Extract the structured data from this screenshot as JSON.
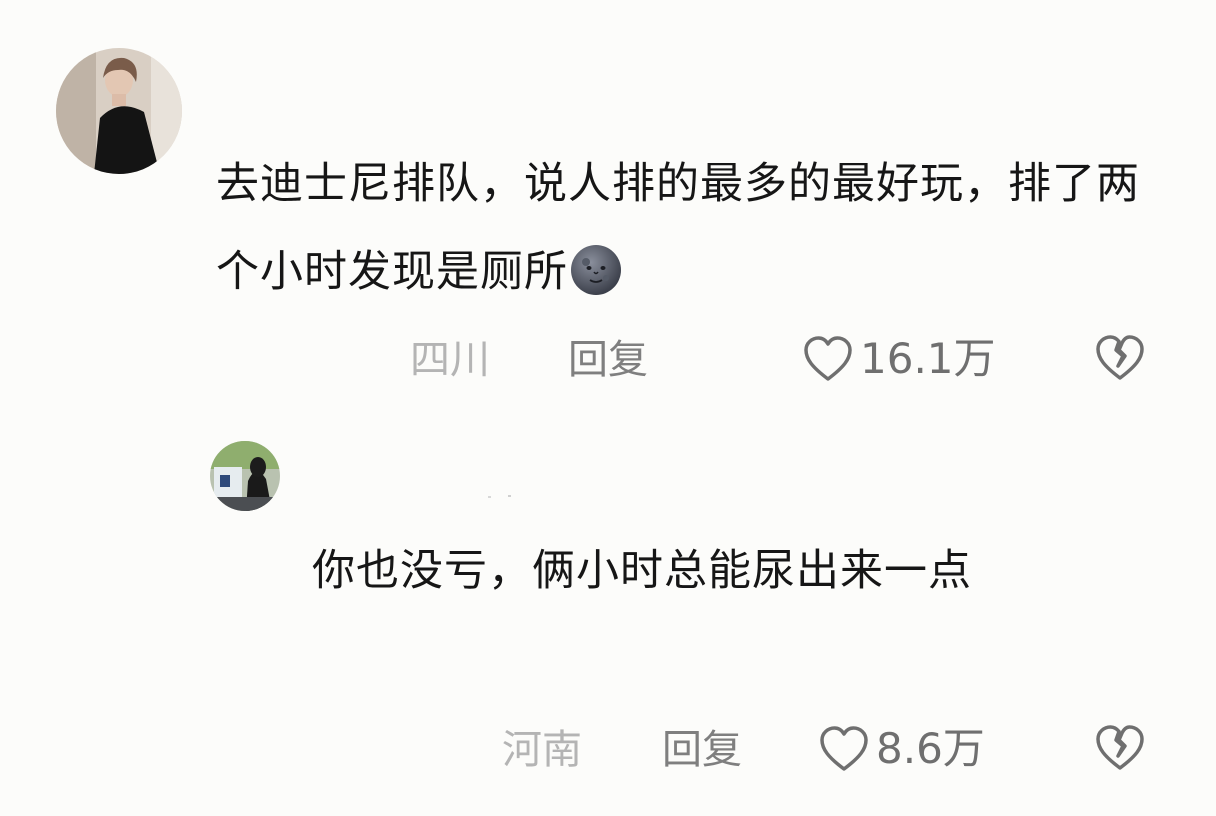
{
  "comments": [
    {
      "text": "去迪士尼排队，说人排的最多的最好玩，排了两个小时发现是厕所",
      "emoji": "new-moon-face-emoji",
      "location": "四川",
      "reply_label": "回复",
      "likes": "16.1万",
      "icons": {
        "like": "heart-outline-icon",
        "dislike": "broken-heart-icon"
      }
    },
    {
      "text": "你也没亏，俩小时总能尿出来一点",
      "location": "河南",
      "reply_label": "回复",
      "likes": "8.6万",
      "icons": {
        "like": "heart-outline-icon",
        "dislike": "broken-heart-icon"
      }
    }
  ],
  "colors": {
    "background": "#fcfcfa",
    "text": "#161616",
    "location": "#b4b4b4",
    "meta": "#7f7f7f"
  }
}
